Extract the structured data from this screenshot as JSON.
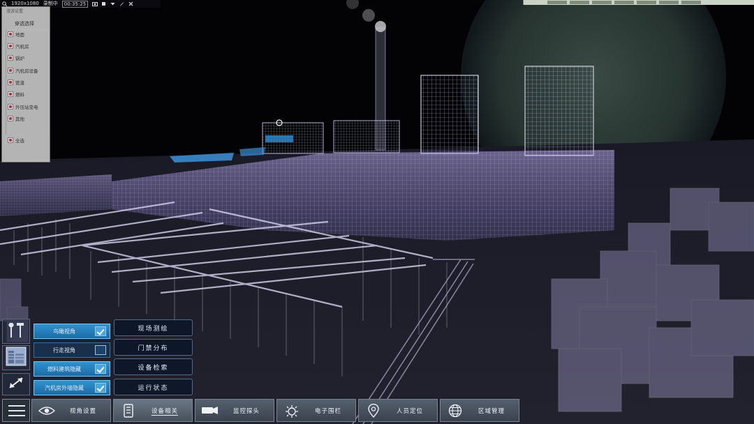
{
  "statusbar": {
    "resolution": "1920x1080",
    "mode": "录制中",
    "timer": "00:35:25"
  },
  "layer_panel": {
    "title": "漫游设置",
    "subtitle": "穿透选择",
    "items": [
      {
        "label": "地面",
        "checked": true
      },
      {
        "label": "汽机房",
        "checked": true
      },
      {
        "label": "锅炉",
        "checked": true
      },
      {
        "label": "汽机房设备",
        "checked": true
      },
      {
        "label": "管道",
        "checked": true
      },
      {
        "label": "燃料",
        "checked": true
      },
      {
        "label": "升压站变电",
        "checked": true
      },
      {
        "label": "其他",
        "checked": true
      }
    ],
    "select_all": {
      "label": "全选",
      "checked": true
    }
  },
  "view_options": [
    {
      "label": "鸟瞰视角",
      "checked": true
    },
    {
      "label": "行走视角",
      "checked": false
    },
    {
      "label": "燃料建筑隐藏",
      "checked": true
    },
    {
      "label": "汽机房外墙隐藏",
      "checked": true
    }
  ],
  "sub_menu": [
    "现场测绘",
    "门禁分布",
    "设备检索",
    "运行状态"
  ],
  "nav": [
    {
      "label": "视角设置",
      "icon": "eye-icon"
    },
    {
      "label": "设备相关",
      "icon": "device-icon",
      "active": true
    },
    {
      "label": "监控探头",
      "icon": "camera-icon"
    },
    {
      "label": "电子围栏",
      "icon": "fence-icon"
    },
    {
      "label": "人员定位",
      "icon": "location-pin-icon"
    },
    {
      "label": "区域管理",
      "icon": "globe-icon"
    }
  ],
  "tools": [
    "wrench-hammer-icon",
    "building-thumbnail-icon",
    "resize-arrows-icon",
    "menu-icon"
  ],
  "colors": {
    "accent": "#2e93cf",
    "panel": "#0a1628",
    "wireframe": "#b9a8ff",
    "checkbox_mark": "#c0333a"
  }
}
